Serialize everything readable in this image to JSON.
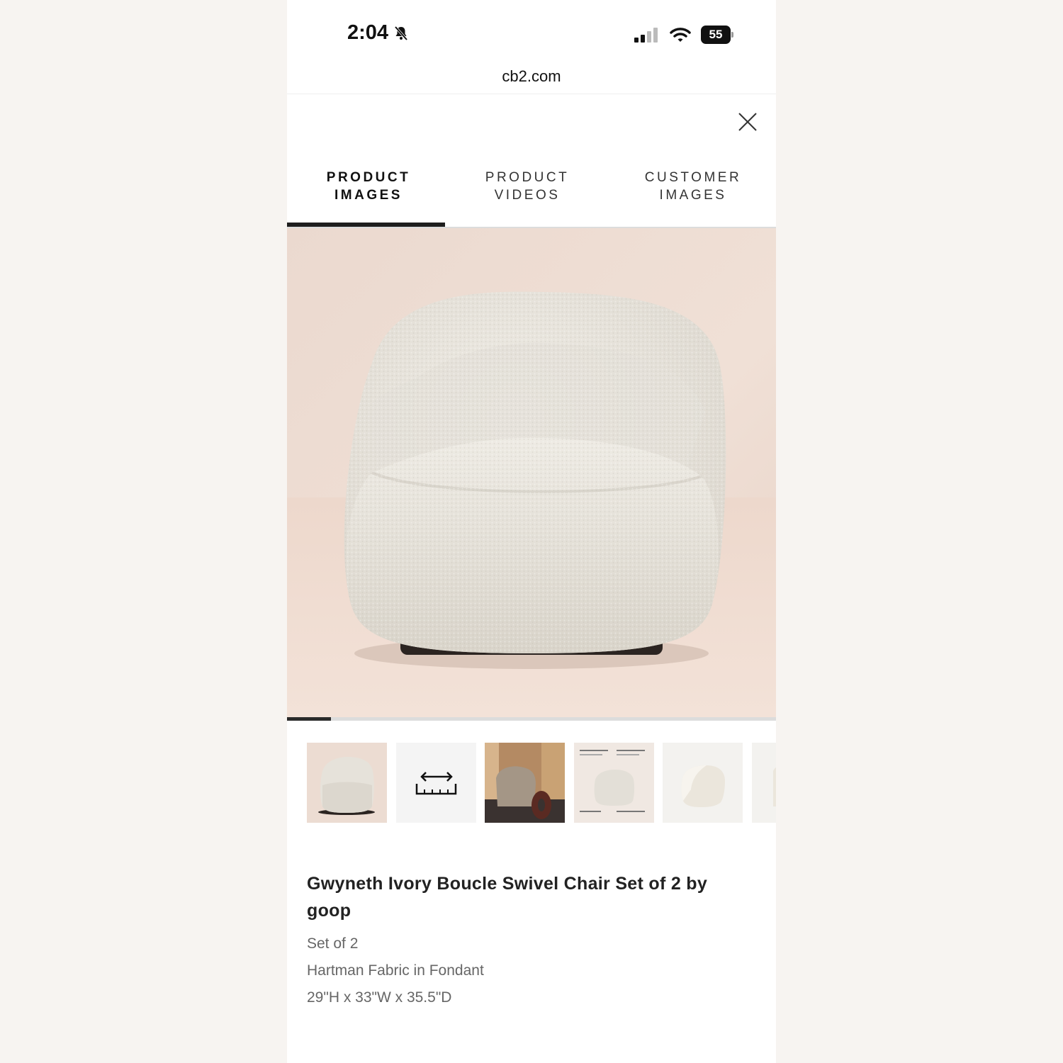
{
  "status_bar": {
    "time": "2:04",
    "battery": "55"
  },
  "browser": {
    "url": "cb2.com"
  },
  "tabs": [
    {
      "line1": "PRODUCT",
      "line2": "IMAGES",
      "active": true
    },
    {
      "line1": "PRODUCT",
      "line2": "VIDEOS",
      "active": false
    },
    {
      "line1": "CUSTOMER",
      "line2": "IMAGES",
      "active": false
    }
  ],
  "gallery": {
    "progress_fraction": 0.09,
    "thumbnails": [
      "chair-front-thumbnail",
      "dimensions-icon-thumbnail",
      "lifestyle-room-thumbnail",
      "feature-callouts-thumbnail",
      "chair-angle-thumbnail",
      "chair-side-thumbnail"
    ],
    "selected_index": 0
  },
  "product": {
    "title": "Gwyneth Ivory Boucle Swivel Chair Set of 2 by goop",
    "specs": [
      "Set of 2",
      "Hartman Fabric in Fondant",
      "29\"H x 33\"W x 35.5\"D"
    ]
  },
  "colors": {
    "background_backdrop": "#e9d6cc",
    "chair_fabric": "#ece8e0",
    "tab_underline": "#1e1e1e"
  }
}
